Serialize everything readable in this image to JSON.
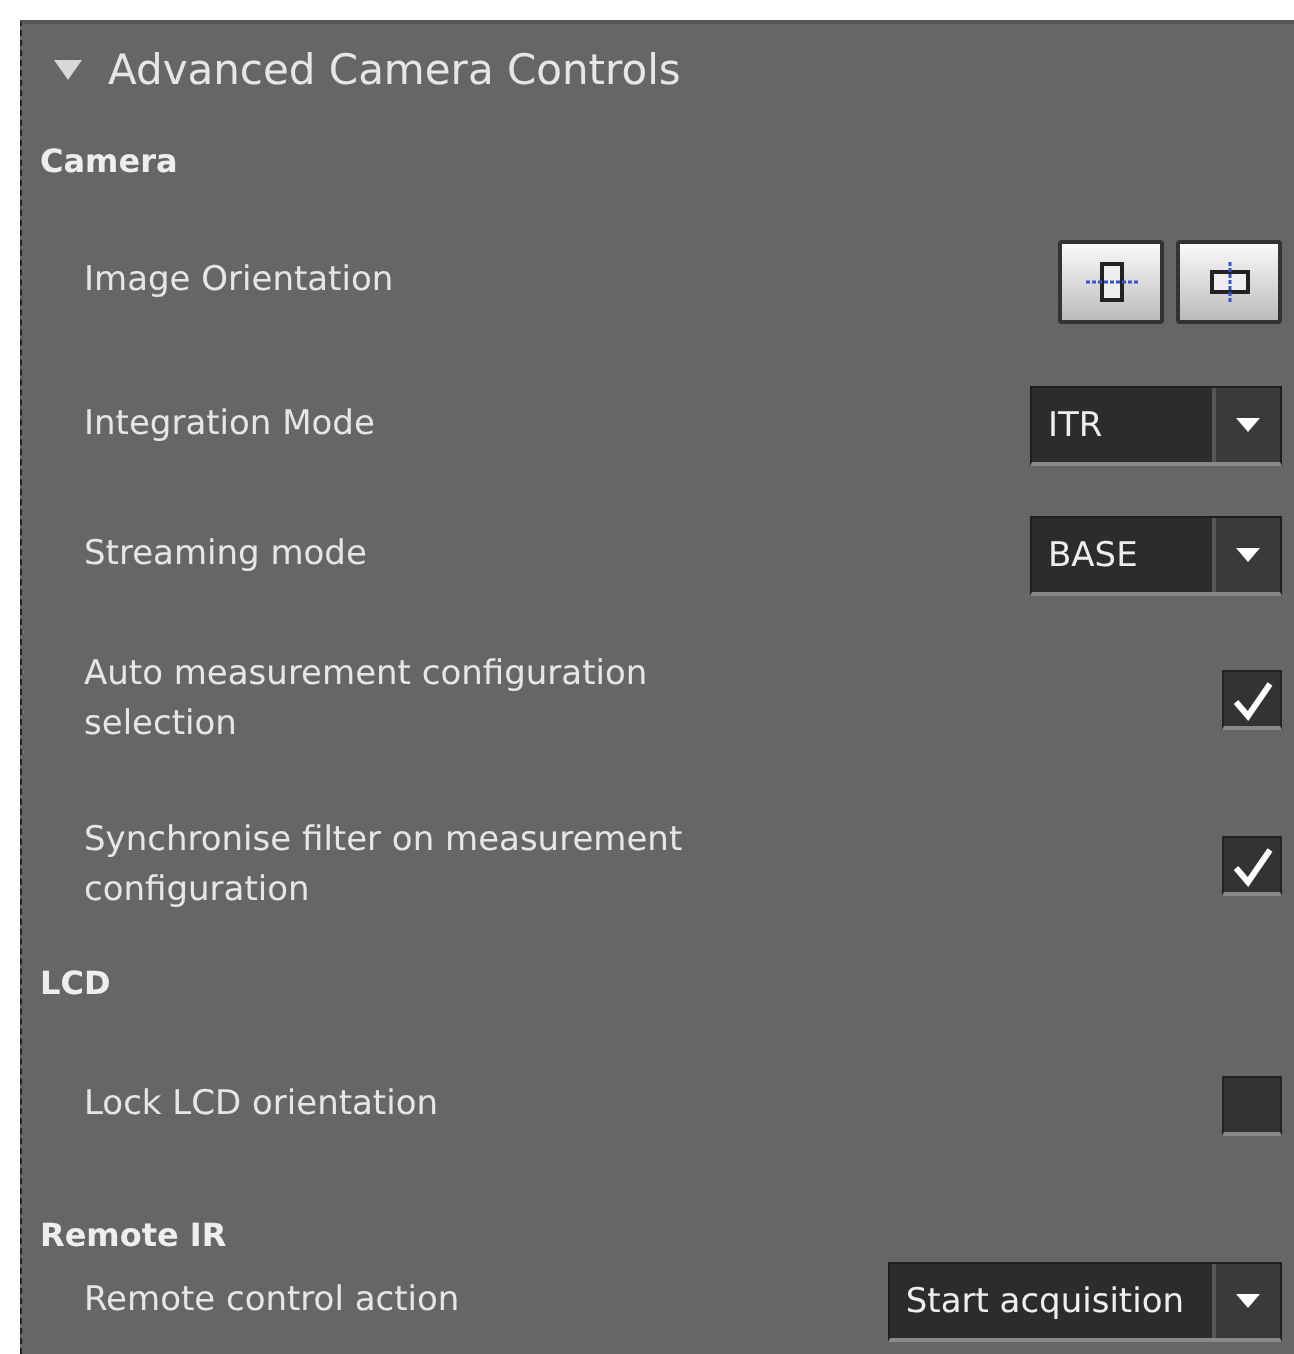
{
  "panel": {
    "title": "Advanced Camera Controls",
    "expanded": true
  },
  "sections": [
    {
      "heading": "Camera",
      "items": [
        {
          "kind": "orientation",
          "label": "Image Orientation",
          "options": [
            {
              "selected": false
            },
            {
              "selected": false
            }
          ]
        },
        {
          "kind": "dropdown",
          "label": "Integration Mode",
          "value": "ITR"
        },
        {
          "kind": "dropdown",
          "label": "Streaming mode",
          "value": "BASE"
        },
        {
          "kind": "checkbox",
          "label": "Auto measurement configuration selection",
          "checked": true
        },
        {
          "kind": "checkbox",
          "label": "Synchronise filter on measurement configuration",
          "checked": true
        }
      ]
    },
    {
      "heading": "LCD",
      "items": [
        {
          "kind": "checkbox",
          "label": "Lock LCD orientation",
          "checked": false
        }
      ]
    },
    {
      "heading": "Remote IR",
      "items": [
        {
          "kind": "dropdown",
          "label": "Remote control action",
          "value": "Start acquisition"
        }
      ]
    }
  ]
}
